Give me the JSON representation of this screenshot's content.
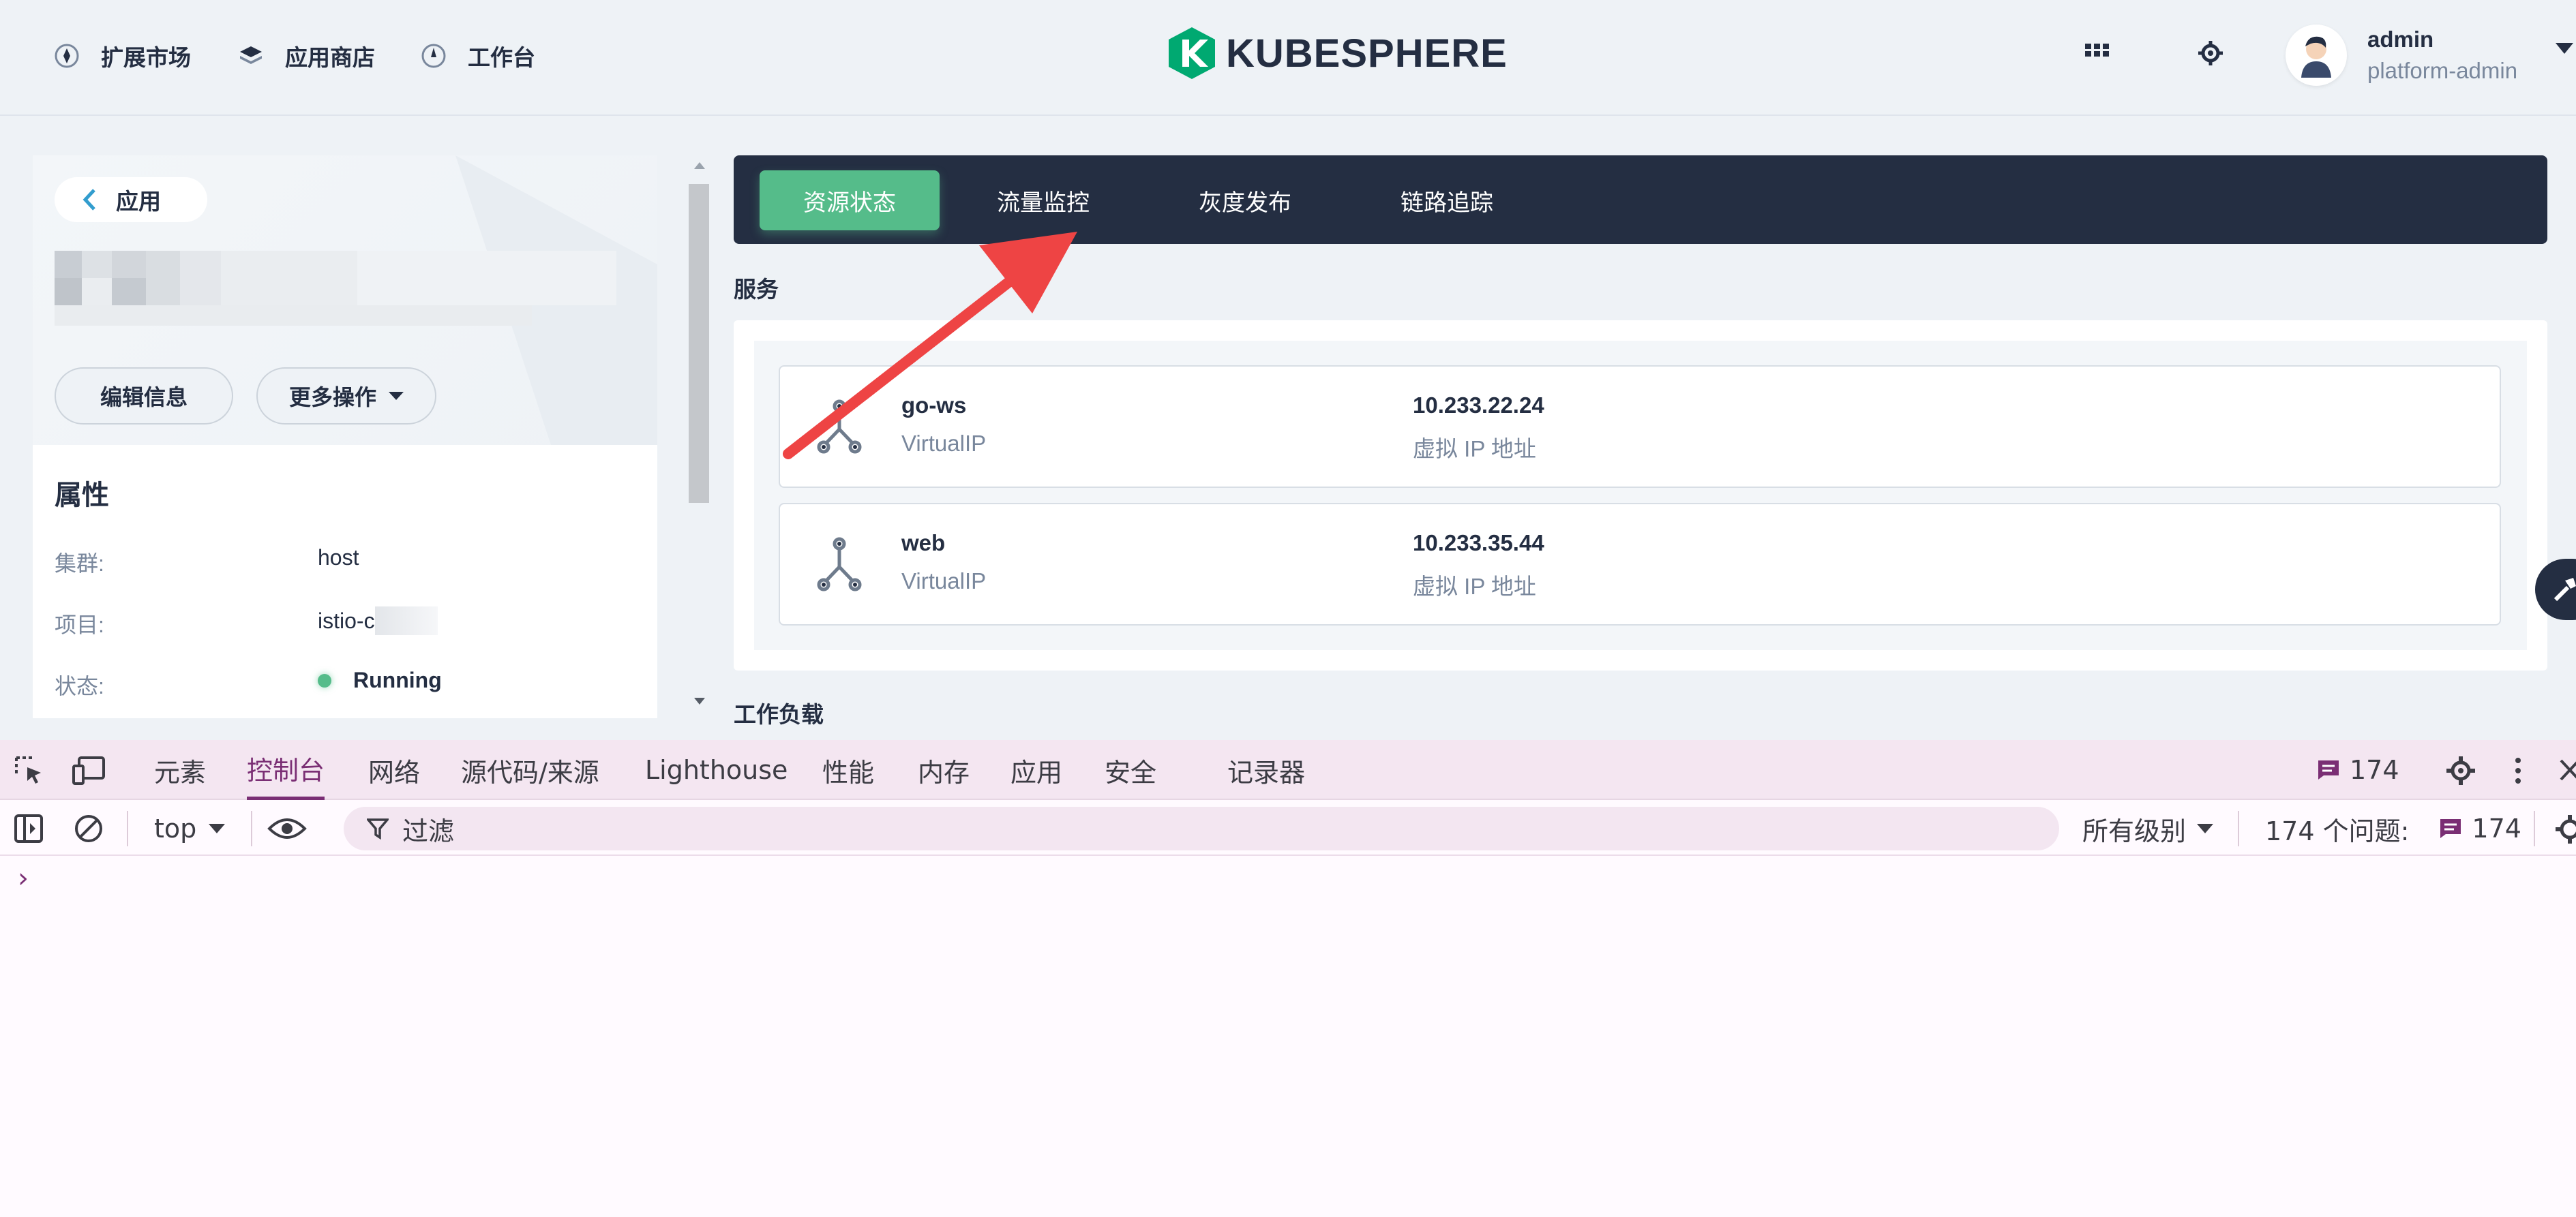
{
  "topnav": {
    "items": [
      {
        "label": "扩展市场",
        "icon": "extension-market-icon"
      },
      {
        "label": "应用商店",
        "icon": "layers-icon"
      },
      {
        "label": "工作台",
        "icon": "workbench-icon"
      }
    ],
    "logo_text": "KUBESPHERE",
    "user": {
      "name": "admin",
      "role": "platform-admin"
    }
  },
  "left_panel": {
    "back_label": "应用",
    "edit_label": "编辑信息",
    "more_label": "更多操作",
    "properties_title": "属性",
    "properties": [
      {
        "label": "集群:",
        "value": "host"
      },
      {
        "label": "项目:",
        "value": "istio-c"
      },
      {
        "label": "状态:",
        "value": "Running"
      }
    ],
    "status_color": "#55bc8a"
  },
  "tabs": [
    {
      "label": "资源状态",
      "active": true
    },
    {
      "label": "流量监控",
      "active": false
    },
    {
      "label": "灰度发布",
      "active": false
    },
    {
      "label": "链路追踪",
      "active": false
    }
  ],
  "services": {
    "title": "服务",
    "items": [
      {
        "name": "go-ws",
        "type": "VirtualIP",
        "ip": "10.233.22.24",
        "ip_label": "虚拟 IP 地址"
      },
      {
        "name": "web",
        "type": "VirtualIP",
        "ip": "10.233.35.44",
        "ip_label": "虚拟 IP 地址"
      }
    ]
  },
  "workloads_title": "工作负载",
  "devtools": {
    "tabs": [
      "元素",
      "控制台",
      "网络",
      "源代码/来源",
      "Lighthouse",
      "性能",
      "内存",
      "应用",
      "安全",
      "记录器"
    ],
    "active_tab": "控制台",
    "issue_count": "174",
    "context": "top",
    "filter_placeholder": "过滤",
    "levels": "所有级别",
    "issues_label": "174 个问题:",
    "issues_badge": "174",
    "prompt": "›"
  },
  "colors": {
    "accent": "#55bc8a",
    "nav_dark": "#242e42",
    "arrow": "#ee4444",
    "devtools_accent": "#7a2e74"
  }
}
